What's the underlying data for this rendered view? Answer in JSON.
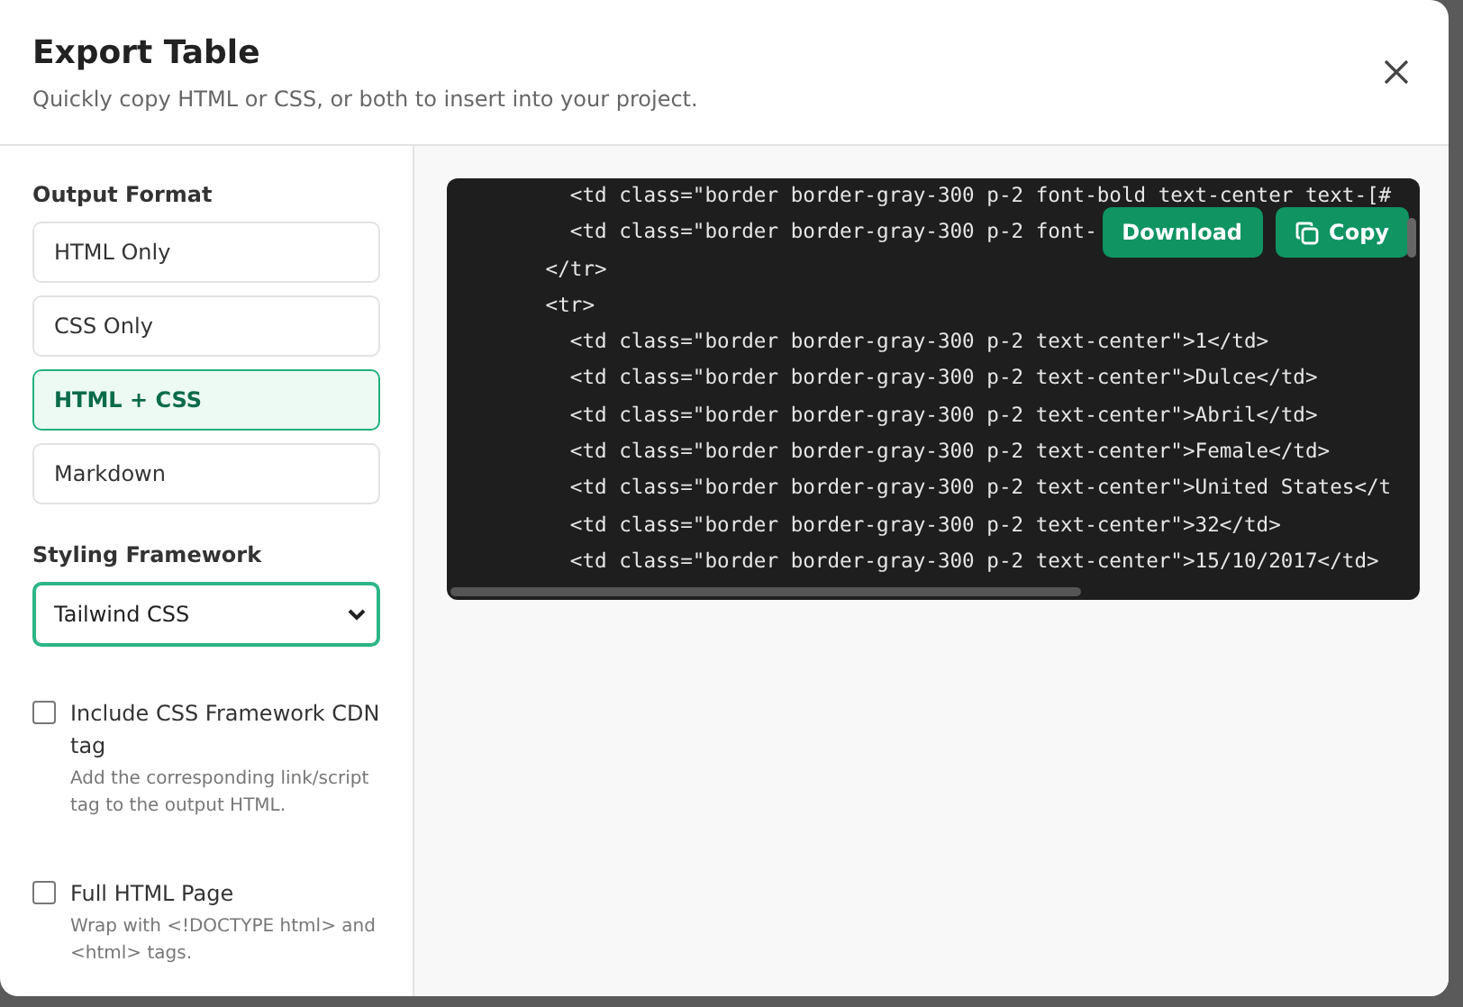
{
  "dialog": {
    "title": "Export Table",
    "subtitle": "Quickly copy HTML or CSS, or both to insert into your project."
  },
  "output_format": {
    "label": "Output Format",
    "options": [
      {
        "label": "HTML Only",
        "selected": false
      },
      {
        "label": "CSS Only",
        "selected": false
      },
      {
        "label": "HTML + CSS",
        "selected": true
      },
      {
        "label": "Markdown",
        "selected": false
      }
    ]
  },
  "styling_framework": {
    "label": "Styling Framework",
    "value": "Tailwind CSS"
  },
  "options": [
    {
      "label": "Include CSS Framework CDN tag",
      "description": "Add the corresponding link/script tag to the output HTML.",
      "checked": false
    },
    {
      "label": "Full HTML Page",
      "description": "Wrap with <!DOCTYPE html> and <html> tags.",
      "checked": false
    }
  ],
  "code": {
    "lines": [
      "        <td class=\"border border-gray-300 p-2 font-bold text-center text-[#",
      "        <td class=\"border border-gray-300 p-2 font-",
      "      </tr>",
      "      <tr>",
      "        <td class=\"border border-gray-300 p-2 text-center\">1</td>",
      "        <td class=\"border border-gray-300 p-2 text-center\">Dulce</td>",
      "        <td class=\"border border-gray-300 p-2 text-center\">Abril</td>",
      "        <td class=\"border border-gray-300 p-2 text-center\">Female</td>",
      "        <td class=\"border border-gray-300 p-2 text-center\">United States</t",
      "        <td class=\"border border-gray-300 p-2 text-center\">32</td>",
      "        <td class=\"border border-gray-300 p-2 text-center\">15/10/2017</td>"
    ],
    "buttons": [
      "Download",
      "Copy"
    ]
  }
}
